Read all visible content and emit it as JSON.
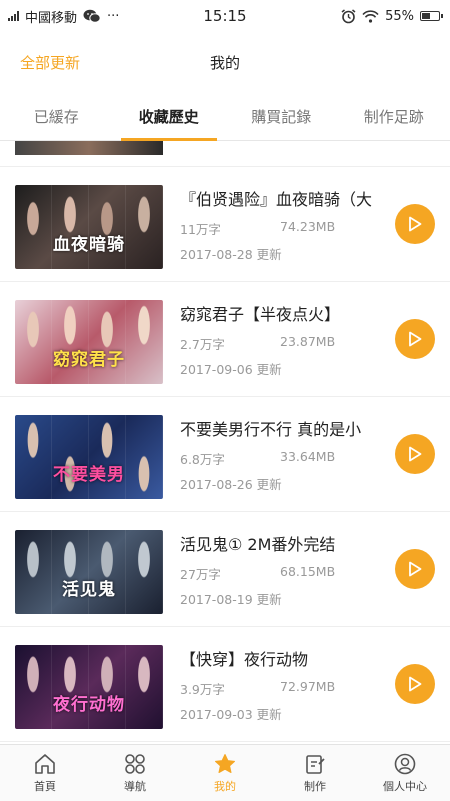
{
  "statusbar": {
    "carrier": "中國移動",
    "wechat_icon": "wechat-icon",
    "more": "···",
    "time": "15:15",
    "battery": "55%",
    "battery_level": 0.55
  },
  "header": {
    "update_all": "全部更新",
    "title": "我的"
  },
  "tabs": [
    {
      "label": "已緩存"
    },
    {
      "label": "收藏歷史",
      "active": true
    },
    {
      "label": "購買記錄"
    },
    {
      "label": "制作足跡"
    }
  ],
  "items": [
    {
      "title": "『伯贤遇险』血夜暗骑（大",
      "words": "11万字",
      "size": "74.23MB",
      "date": "2017-08-28 更新",
      "cover_text": "血夜暗骑"
    },
    {
      "title": "窈窕君子【半夜点火】",
      "words": "2.7万字",
      "size": "23.87MB",
      "date": "2017-09-06 更新",
      "cover_text": "窈窕君子"
    },
    {
      "title": "不要美男行不行 真的是小",
      "words": "6.8万字",
      "size": "33.64MB",
      "date": "2017-08-26 更新",
      "cover_text": "不要美男"
    },
    {
      "title": "活见鬼① 2M番外完结",
      "words": "27万字",
      "size": "68.15MB",
      "date": "2017-08-19 更新",
      "cover_text": "活见鬼"
    },
    {
      "title": "【快穿】夜行动物",
      "words": "3.9万字",
      "size": "72.97MB",
      "date": "2017-09-03 更新",
      "cover_text": "夜行动物"
    }
  ],
  "bottomnav": [
    {
      "label": "首頁",
      "icon": "home-icon"
    },
    {
      "label": "導航",
      "icon": "grid-icon"
    },
    {
      "label": "我的",
      "icon": "star-icon",
      "active": true
    },
    {
      "label": "制作",
      "icon": "edit-icon"
    },
    {
      "label": "個人中心",
      "icon": "profile-icon"
    }
  ],
  "colors": {
    "accent": "#f5a623"
  }
}
